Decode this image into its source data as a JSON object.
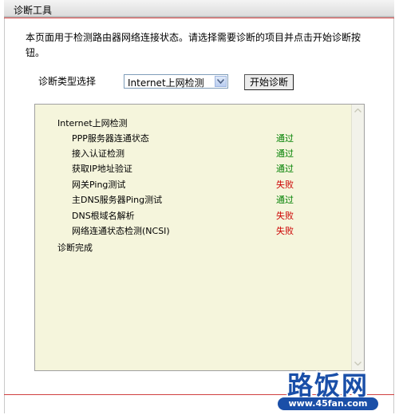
{
  "header": {
    "title": "诊断工具"
  },
  "description": "本页面用于检测路由器网络连接状态。请选择需要诊断的项目并点击开始诊断按钮。",
  "diagnosis_type": {
    "label": "诊断类型选择",
    "selected": "Internet上网检测"
  },
  "start_button": {
    "label": "开始诊断"
  },
  "results": {
    "heading": "Internet上网检测",
    "items": [
      {
        "name": "PPP服务器连通状态",
        "status": "通过",
        "state": "pass"
      },
      {
        "name": "接入认证检测",
        "status": "通过",
        "state": "pass"
      },
      {
        "name": "获取IP地址验证",
        "status": "通过",
        "state": "pass"
      },
      {
        "name": "网关Ping测试",
        "status": "失败",
        "state": "fail"
      },
      {
        "name": "主DNS服务器Ping测试",
        "status": "通过",
        "state": "pass"
      },
      {
        "name": "DNS根域名解析",
        "status": "失败",
        "state": "fail"
      },
      {
        "name": "网络连通状态检测(NCSI)",
        "status": "失败",
        "state": "fail"
      }
    ],
    "footer": "诊断完成"
  },
  "watermark": {
    "logo": "路饭网",
    "url": "www.45fan.com"
  },
  "colors": {
    "pass": "#008000",
    "fail": "#cc0000",
    "result_bg": "#f5f5dc",
    "accent_line": "#d04040",
    "watermark": "#1a4fa8"
  }
}
